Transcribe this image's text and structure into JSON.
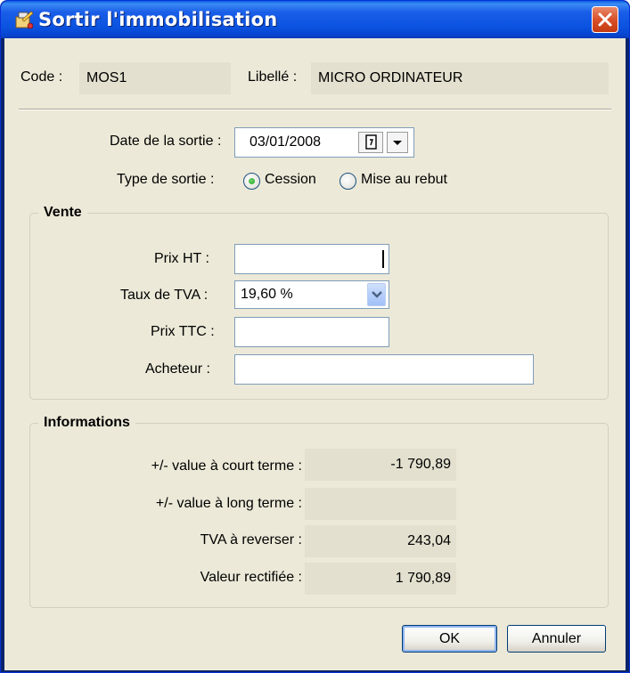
{
  "window": {
    "title": "Sortir l'immobilisation",
    "title_color": "#ffffff",
    "titlebar_color": "#0a53e0",
    "close_color": "#d8502a"
  },
  "header": {
    "code_label": "Code :",
    "code_value": "MOS1",
    "libelle_label": "Libellé :",
    "libelle_value": "MICRO ORDINATEUR"
  },
  "sortie": {
    "date_label": "Date de la sortie :",
    "date_value": "03/01/2008",
    "type_label": "Type de sortie :",
    "options": [
      {
        "label": "Cession",
        "selected": true
      },
      {
        "label": "Mise au rebut",
        "selected": false
      }
    ]
  },
  "vente": {
    "title": "Vente",
    "prix_ht_label": "Prix HT :",
    "prix_ht_value": "",
    "taux_tva_label": "Taux de TVA :",
    "taux_tva_value": "19,60 %",
    "prix_ttc_label": "Prix TTC :",
    "prix_ttc_value": "",
    "acheteur_label": "Acheteur :",
    "acheteur_value": ""
  },
  "informations": {
    "title": "Informations",
    "rows": [
      {
        "label": "+/- value à court terme :",
        "value": "-1 790,89"
      },
      {
        "label": "+/- value à long terme :",
        "value": ""
      },
      {
        "label": "TVA à reverser :",
        "value": "243,04"
      },
      {
        "label": "Valeur rectifiée :",
        "value": "1 790,89"
      }
    ]
  },
  "buttons": {
    "ok": "OK",
    "cancel": "Annuler"
  }
}
